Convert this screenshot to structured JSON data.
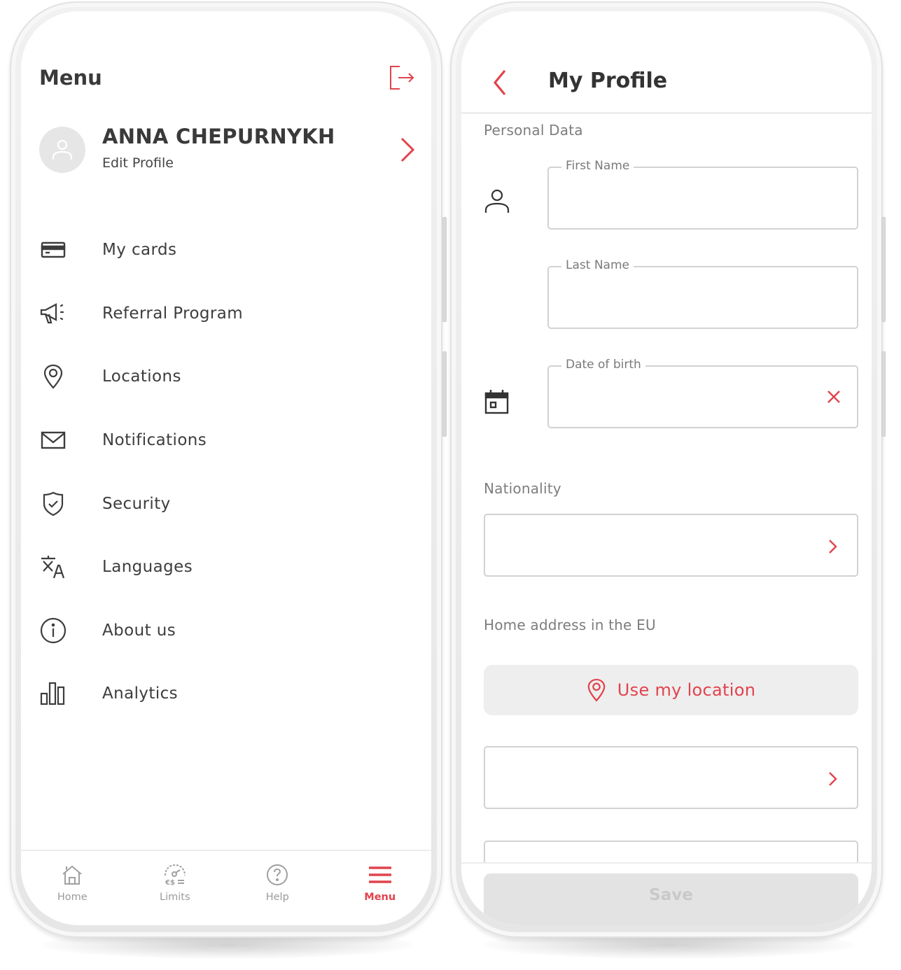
{
  "colors": {
    "accent": "#e2434d",
    "text_dark": "#3a3a3a",
    "text_muted": "#7d7d7d",
    "border": "#d2d2d2",
    "button_bg": "#eeeeee",
    "disabled_bg": "#e3e3e3",
    "disabled_text": "#c9c9c9"
  },
  "menu_screen": {
    "title": "Menu",
    "logout_icon": "logout-icon",
    "profile": {
      "name": "ANNA CHEPURNYKH",
      "subtitle": "Edit Profile",
      "avatar_icon": "user-icon",
      "chevron_icon": "chevron-right-icon"
    },
    "items": [
      {
        "label": "My cards",
        "icon": "credit-card-icon"
      },
      {
        "label": "Referral Program",
        "icon": "megaphone-icon"
      },
      {
        "label": "Locations",
        "icon": "map-pin-icon"
      },
      {
        "label": "Notifications",
        "icon": "envelope-icon"
      },
      {
        "label": "Security",
        "icon": "shield-check-icon"
      },
      {
        "label": "Languages",
        "icon": "translate-icon"
      },
      {
        "label": "About us",
        "icon": "info-icon"
      },
      {
        "label": "Analytics",
        "icon": "bar-chart-icon"
      }
    ],
    "tabbar": [
      {
        "label": "Home",
        "icon": "home-icon",
        "active": false
      },
      {
        "label": "Limits",
        "icon": "gauge-currency-icon",
        "active": false
      },
      {
        "label": "Help",
        "icon": "help-circle-icon",
        "active": false
      },
      {
        "label": "Menu",
        "icon": "hamburger-icon",
        "active": true
      }
    ]
  },
  "profile_screen": {
    "title": "My Profile",
    "back_icon": "chevron-left-icon",
    "sections": {
      "personal_data": "Personal Data",
      "nationality": "Nationality",
      "home_address": "Home address in the EU"
    },
    "fields": {
      "first_name": {
        "label": "First Name",
        "value": ""
      },
      "last_name": {
        "label": "Last Name",
        "value": ""
      },
      "date_of_birth": {
        "label": "Date of birth",
        "value": ""
      }
    },
    "nationality_select": {
      "value": ""
    },
    "address_select": {
      "value": ""
    },
    "use_location_label": "Use my location",
    "save_label": "Save"
  }
}
